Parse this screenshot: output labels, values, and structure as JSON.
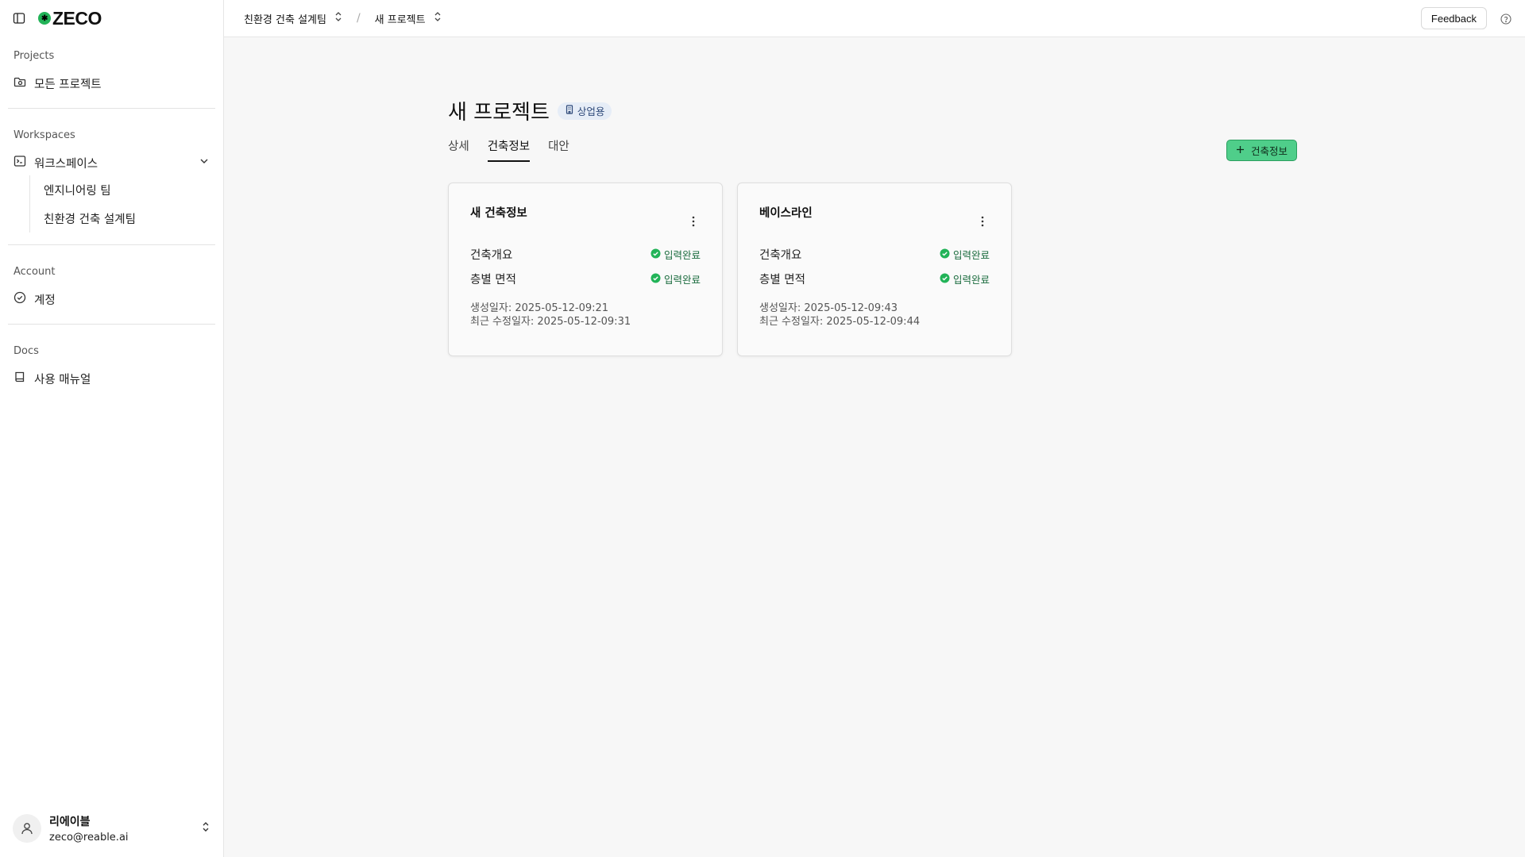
{
  "brand": {
    "name": "ZECO",
    "accent": "#22b358"
  },
  "sidebar": {
    "projects_label": "Projects",
    "all_projects": "모든 프로젝트",
    "workspaces_label": "Workspaces",
    "workspace": "워크스페이스",
    "workspace_items": [
      "엔지니어링 팀",
      "친환경 건축 설계팀"
    ],
    "account_label": "Account",
    "account_item": "계정",
    "docs_label": "Docs",
    "docs_item": "사용 매뉴얼",
    "user": {
      "name": "리에이블",
      "email": "zeco@reable.ai"
    }
  },
  "header": {
    "breadcrumb": [
      "친환경 건축 설계팀",
      "새 프로젝트"
    ],
    "breadcrumb_sep": "/",
    "feedback_label": "Feedback"
  },
  "page": {
    "title": "새 프로젝트",
    "badge": "상업용",
    "tabs": [
      "상세",
      "건축정보",
      "대안"
    ],
    "active_tab": "건축정보",
    "add_button_label": "건축정보"
  },
  "cards": [
    {
      "title": "새 건축정보",
      "rows": [
        {
          "label": "건축개요",
          "status": "입력완료"
        },
        {
          "label": "층별 면적",
          "status": "입력완료"
        }
      ],
      "created": "생성일자: 2025-05-12-09:21",
      "modified": "최근 수정일자: 2025-05-12-09:31"
    },
    {
      "title": "베이스라인",
      "rows": [
        {
          "label": "건축개요",
          "status": "입력완료"
        },
        {
          "label": "층별 면적",
          "status": "입력완료"
        }
      ],
      "created": "생성일자: 2025-05-12-09:43",
      "modified": "최근 수정일자: 2025-05-12-09:44"
    }
  ],
  "colors": {
    "status_green": "#22b358",
    "add_button": "#4fce8a",
    "badge_bg": "#e6edf7"
  }
}
